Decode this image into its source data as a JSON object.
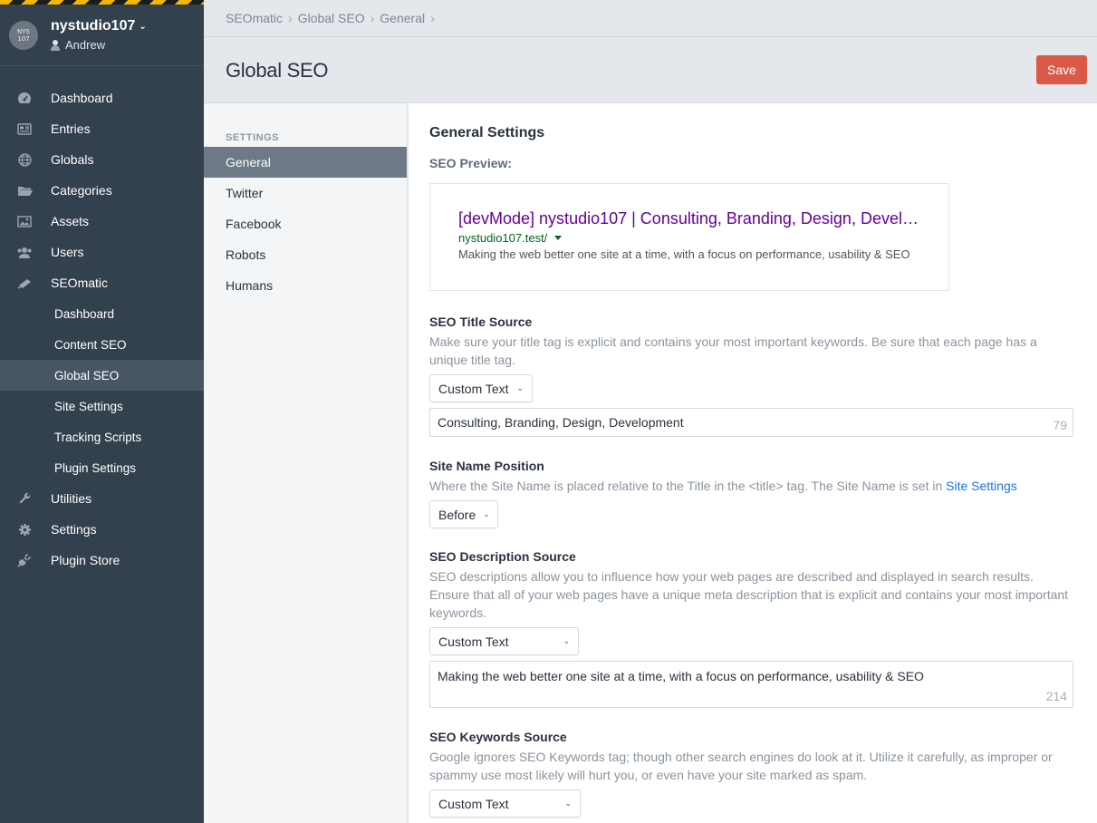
{
  "site": {
    "name": "nystudio107",
    "user": "Andrew",
    "logo_lines": [
      "NYS",
      "107"
    ]
  },
  "nav": {
    "items": [
      {
        "label": "Dashboard",
        "icon": "speedometer-icon"
      },
      {
        "label": "Entries",
        "icon": "newspaper-icon"
      },
      {
        "label": "Globals",
        "icon": "globe-icon"
      },
      {
        "label": "Categories",
        "icon": "folder-icon"
      },
      {
        "label": "Assets",
        "icon": "image-icon"
      },
      {
        "label": "Users",
        "icon": "users-icon"
      },
      {
        "label": "SEOmatic",
        "icon": "seomatic-icon"
      }
    ],
    "seomatic_sub": [
      "Dashboard",
      "Content SEO",
      "Global SEO",
      "Site Settings",
      "Tracking Scripts",
      "Plugin Settings"
    ],
    "bottom_items": [
      {
        "label": "Utilities",
        "icon": "wrench-icon"
      },
      {
        "label": "Settings",
        "icon": "gear-icon"
      },
      {
        "label": "Plugin Store",
        "icon": "plug-icon"
      }
    ]
  },
  "breadcrumb": [
    "SEOmatic",
    "Global SEO",
    "General"
  ],
  "header": {
    "title": "Global SEO",
    "save_label": "Save"
  },
  "subnav": {
    "heading": "SETTINGS",
    "items": [
      "General",
      "Twitter",
      "Facebook",
      "Robots",
      "Humans"
    ]
  },
  "content": {
    "section_title": "General Settings",
    "preview_label": "SEO Preview:",
    "preview": {
      "title": "[devMode] nystudio107 | Consulting, Branding, Design, Devel…",
      "url": "nystudio107.test/",
      "description": "Making the web better one site at a time, with a focus on performance, usability & SEO"
    },
    "title_source": {
      "label": "SEO Title Source",
      "instructions": "Make sure your title tag is explicit and contains your most important keywords. Be sure that each page has a unique title tag.",
      "select": "Custom Text",
      "value": "Consulting, Branding, Design, Development",
      "count": "79"
    },
    "site_name_position": {
      "label": "Site Name Position",
      "instructions": "Where the Site Name is placed relative to the Title in the <title> tag. The Site Name is set in",
      "link": "Site Settings",
      "select": "Before"
    },
    "description_source": {
      "label": "SEO Description Source",
      "instructions": "SEO descriptions allow you to influence how your web pages are described and displayed in search results. Ensure that all of your web pages have a unique meta description that is explicit and contains your most important keywords.",
      "select": "Custom Text",
      "value": "Making the web better one site at a time, with a focus on performance, usability & SEO",
      "count": "214"
    },
    "keywords_source": {
      "label": "SEO Keywords Source",
      "instructions": "Google ignores SEO Keywords tag; though other search engines do look at it. Utilize it carefully, as improper or spammy use most likely will hurt you, or even have your site marked as spam.",
      "select": "Custom Text"
    }
  }
}
